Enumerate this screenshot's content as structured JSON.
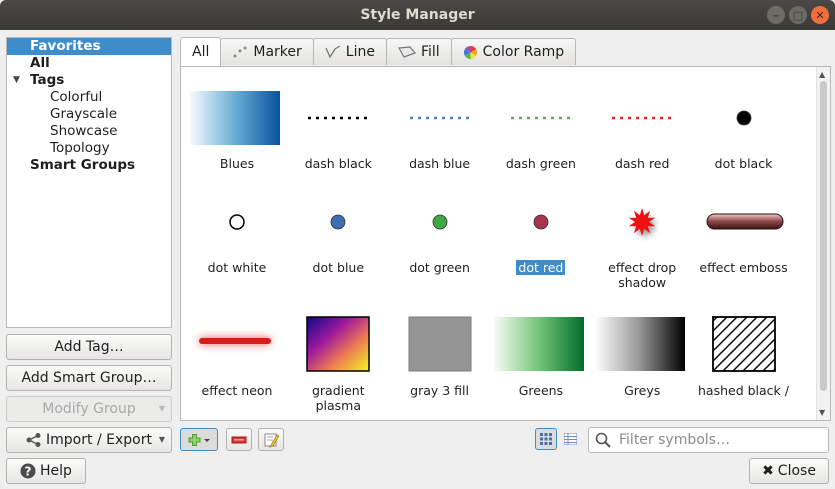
{
  "window": {
    "title": "Style Manager"
  },
  "tree": {
    "items": [
      {
        "label": "Favorites",
        "level": 0,
        "selected": true
      },
      {
        "label": "All",
        "level": 0
      },
      {
        "label": "Tags",
        "level": 0,
        "expanded": true
      },
      {
        "label": "Colorful",
        "level": 1
      },
      {
        "label": "Grayscale",
        "level": 1
      },
      {
        "label": "Showcase",
        "level": 1
      },
      {
        "label": "Topology",
        "level": 1
      },
      {
        "label": "Smart Groups",
        "level": 0
      }
    ]
  },
  "left_buttons": {
    "add_tag": "Add Tag…",
    "add_smart_group": "Add Smart Group…",
    "modify_group": "Modify Group",
    "import_export": "Import / Export"
  },
  "tabs": [
    {
      "label": "All",
      "icon": "",
      "active": true
    },
    {
      "label": "Marker",
      "icon": "marker-icon"
    },
    {
      "label": "Line",
      "icon": "line-icon"
    },
    {
      "label": "Fill",
      "icon": "fill-icon"
    },
    {
      "label": "Color Ramp",
      "icon": "color-ramp-icon"
    }
  ],
  "symbols": [
    {
      "label": "Blues",
      "kind": "ramp-blues"
    },
    {
      "label": "dash  black",
      "kind": "dash",
      "color": "#000000"
    },
    {
      "label": "dash blue",
      "kind": "dash",
      "color": "#4a7fbf"
    },
    {
      "label": "dash green",
      "kind": "dash",
      "color": "#53b34a"
    },
    {
      "label": "dash red",
      "kind": "dash",
      "color": "#e0262b"
    },
    {
      "label": "dot  black",
      "kind": "dot",
      "color": "#000000"
    },
    {
      "label": "dot  white",
      "kind": "dot-outline",
      "color": "#ffffff"
    },
    {
      "label": "dot blue",
      "kind": "dot",
      "color": "#3d6fb0"
    },
    {
      "label": "dot green",
      "kind": "dot",
      "color": "#3fa844"
    },
    {
      "label": "dot red",
      "kind": "dot",
      "color": "#a8344f",
      "selected": true
    },
    {
      "label": "effect drop shadow",
      "kind": "star",
      "color": "#ee1111"
    },
    {
      "label": "effect emboss",
      "kind": "emboss",
      "color": "#6e2c2c"
    },
    {
      "label": "effect neon",
      "kind": "neon",
      "color": "#dd1a1a"
    },
    {
      "label": "gradient plasma",
      "kind": "plasma"
    },
    {
      "label": "gray 3 fill",
      "kind": "gray",
      "color": "#959595"
    },
    {
      "label": "Greens",
      "kind": "ramp-greens"
    },
    {
      "label": "Greys",
      "kind": "ramp-greys"
    },
    {
      "label": "hashed black /",
      "kind": "hatch"
    }
  ],
  "toolbar": {
    "search_placeholder": "Filter symbols…"
  },
  "footer": {
    "help": "Help",
    "close": "Close"
  }
}
